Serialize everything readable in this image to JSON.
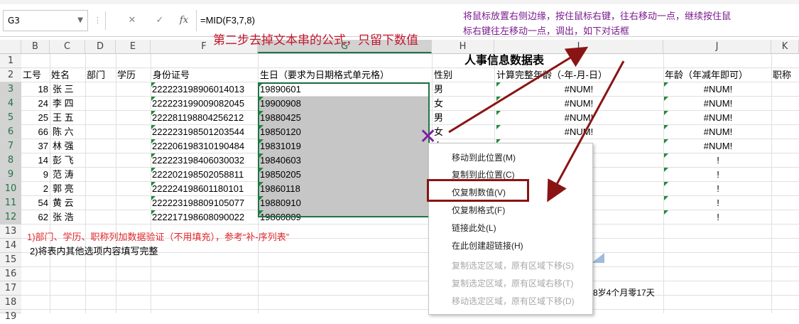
{
  "name_box": {
    "value": "G3"
  },
  "formula_bar": {
    "formula": "=MID(F3,7,8)",
    "cancel_icon": "close-icon",
    "confirm_icon": "check-icon",
    "fx_label": "fx"
  },
  "annotations": {
    "right_line1": "将鼠标放置右侧边缘，按住鼠标右键，往右移动一点，继续按住鼠",
    "right_line2": "标右键往左移动一点，调出，如下对话框",
    "step": "第二步去掉文本串的公式，只留下数值"
  },
  "columns": [
    "B",
    "C",
    "D",
    "E",
    "F",
    "G",
    "H",
    "I",
    "J",
    "K"
  ],
  "selected_column": "G",
  "rows": [
    "1",
    "2",
    "3",
    "4",
    "5",
    "6",
    "7",
    "8",
    "9",
    "10",
    "11",
    "12",
    "13",
    "14",
    "15",
    "16",
    "17",
    "18",
    "19"
  ],
  "sheet": {
    "title": "人事信息数据表",
    "headers": {
      "b": "工号",
      "c": "姓名",
      "d": "部门",
      "e": "学历",
      "f": "身份证号",
      "g": "生日（要求为日期格式单元格）",
      "h": "性别",
      "i": "计算完整年龄（-年-月-日）",
      "j": "年龄（年减年即可）",
      "k": "职称"
    },
    "records": [
      {
        "id": "18",
        "name": "张 三",
        "idcard": "222223198906014013",
        "birth": "19890601",
        "sex": "男",
        "age_full": "#NUM!",
        "age": "#NUM!"
      },
      {
        "id": "24",
        "name": "李 四",
        "idcard": "222223199009082045",
        "birth": "19900908",
        "sex": "女",
        "age_full": "#NUM!",
        "age": "#NUM!"
      },
      {
        "id": "25",
        "name": "王 五",
        "idcard": "222281198804256212",
        "birth": "19880425",
        "sex": "男",
        "age_full": "#NUM!",
        "age": "#NUM!"
      },
      {
        "id": "66",
        "name": "陈 六",
        "idcard": "222223198501203544",
        "birth": "19850120",
        "sex": "女",
        "age_full": "#NUM!",
        "age": "#NUM!"
      },
      {
        "id": "37",
        "name": "林 强",
        "idcard": "222206198310190484",
        "birth": "19831019",
        "sex": "女",
        "age_full": "#NUM!",
        "age": "#NUM!"
      },
      {
        "id": "14",
        "name": "彭 飞",
        "idcard": "222223198406030032",
        "birth": "19840603",
        "sex": "",
        "age_full": "#NUM!",
        "age": "!"
      },
      {
        "id": "9",
        "name": "范 涛",
        "idcard": "222202198502058811",
        "birth": "19850205",
        "sex": "",
        "age_full": "",
        "age": "!"
      },
      {
        "id": "2",
        "name": "郭 亮",
        "idcard": "222224198601180101",
        "birth": "19860118",
        "sex": "",
        "age_full": "",
        "age": "!"
      },
      {
        "id": "54",
        "name": "黄 云",
        "idcard": "222223198809105077",
        "birth": "19880910",
        "sex": "",
        "age_full": "",
        "age": "!"
      },
      {
        "id": "62",
        "name": "张 浩",
        "idcard": "222217198608090022",
        "birth": "19860809",
        "sex": "",
        "age_full": "",
        "age": "!"
      }
    ],
    "note1": "1)部门、学历、职称列加数据验证（不用填充），参考“补-序列表”",
    "note2": "2)将表内其他选项内容填写完整",
    "row18_text": "8岁4个月零17天"
  },
  "context_menu": {
    "items": [
      {
        "label": "移动到此位置(M)",
        "enabled": true
      },
      {
        "label": "复制到此位置(C)",
        "enabled": true
      },
      {
        "label": "仅复制数值(V)",
        "enabled": true,
        "highlighted": true
      },
      {
        "label": "仅复制格式(F)",
        "enabled": true
      },
      {
        "label": "链接此处(L)",
        "enabled": true
      },
      {
        "label": "在此创建超链接(H)",
        "enabled": true
      },
      {
        "label": "复制选定区域，原有区域下移(S)",
        "enabled": false
      },
      {
        "label": "复制选定区域，原有区域右移(T)",
        "enabled": false
      },
      {
        "label": "移动选定区域，原有区域下移(D)",
        "enabled": false
      }
    ]
  },
  "colors": {
    "accent": "#217346",
    "annotation": "#7a1b8f",
    "step_text": "#c0172b",
    "arrow": "#8a1414",
    "highlight_box": "#8a1414"
  }
}
